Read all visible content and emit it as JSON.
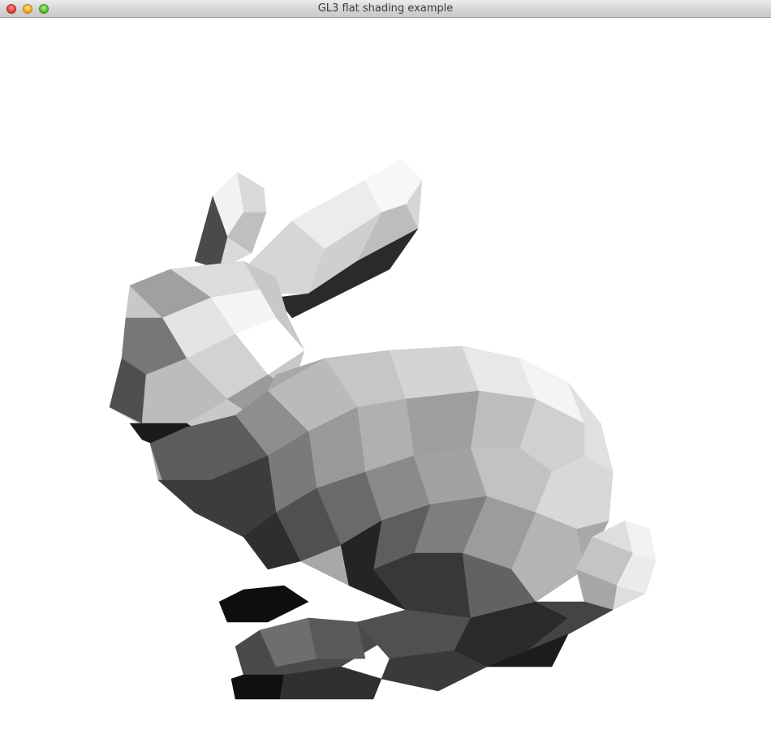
{
  "window": {
    "title": "GL3 flat shading example"
  },
  "colors": {
    "background": "#ffffff",
    "titlebar": "#d3d3d3"
  },
  "viewport": {
    "content": "flat-shaded-bunny-mesh"
  }
}
